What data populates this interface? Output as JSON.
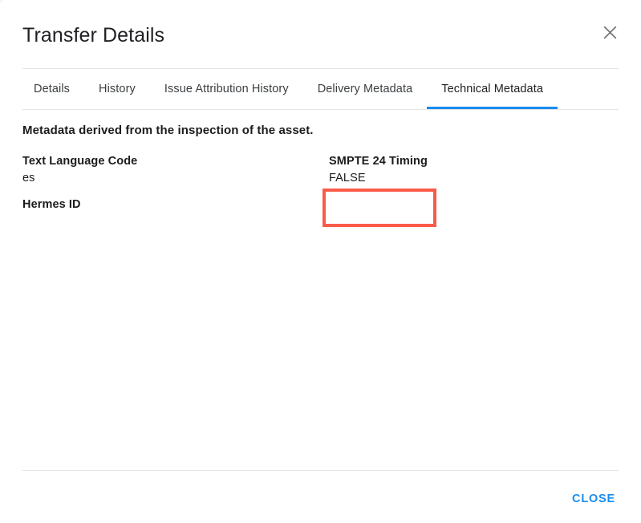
{
  "colors": {
    "accent": "#1a8cf0",
    "annotation": "#fa5a48",
    "text_primary": "#1c1c1c",
    "divider": "#e4e4e4"
  },
  "dialog": {
    "title": "Transfer Details",
    "close_icon": "close-icon"
  },
  "tabs": [
    {
      "label": "Details",
      "active": false
    },
    {
      "label": "History",
      "active": false
    },
    {
      "label": "Issue Attribution History",
      "active": false
    },
    {
      "label": "Delivery Metadata",
      "active": false
    },
    {
      "label": "Technical Metadata",
      "active": true
    }
  ],
  "body": {
    "heading": "Metadata derived from the inspection of the asset.",
    "metadata_rows": [
      {
        "left": {
          "key": "Text Language Code",
          "value": "es"
        },
        "right": {
          "key": "SMPTE 24 Timing",
          "value": "FALSE",
          "highlighted": true
        }
      },
      {
        "left": {
          "key": "Hermes ID",
          "value": ""
        },
        "right": {
          "key": "",
          "value": ""
        }
      }
    ]
  },
  "footer": {
    "close_label": "CLOSE"
  }
}
